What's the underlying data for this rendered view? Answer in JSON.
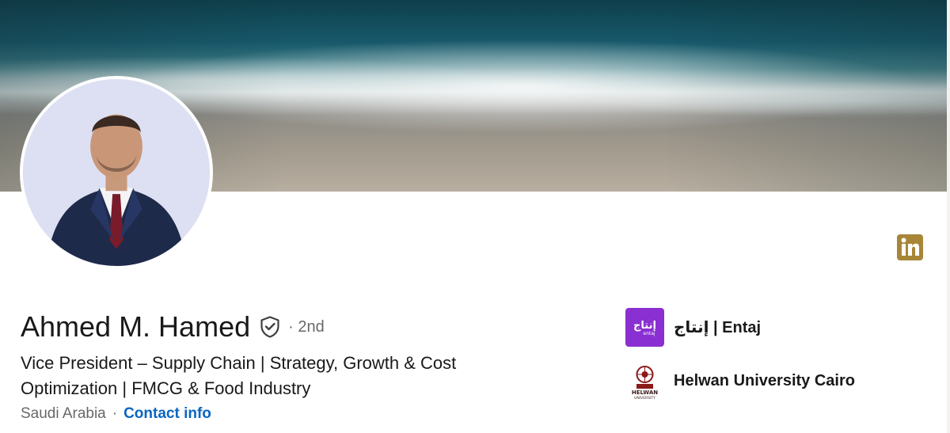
{
  "profile": {
    "name": "Ahmed M. Hamed",
    "degree": "· 2nd",
    "headline": "Vice President – Supply Chain | Strategy, Growth & Cost Optimization | FMCG & Food Industry",
    "location": "Saudi Arabia",
    "separator": "·",
    "contact_info_label": "Contact info"
  },
  "organizations": [
    {
      "name": "إنتاج | Entaj",
      "logo_text": "إنتاج",
      "logo_subtext": "entaj",
      "logo_icon": "entaj-logo",
      "logo_color": "#8a2fd1"
    },
    {
      "name": "Helwan University Cairo",
      "logo_text": "HELWAN",
      "logo_subtext": "UNIVERSITY",
      "logo_icon": "helwan-university-seal",
      "logo_color": "#8b1a1a"
    }
  ],
  "icons": {
    "verified": "shield-check-icon",
    "linkedin": "linkedin-icon"
  },
  "colors": {
    "link": "#0a66c2",
    "linkedin_badge": "#a88638",
    "entaj_purple": "#8a2fd1"
  }
}
